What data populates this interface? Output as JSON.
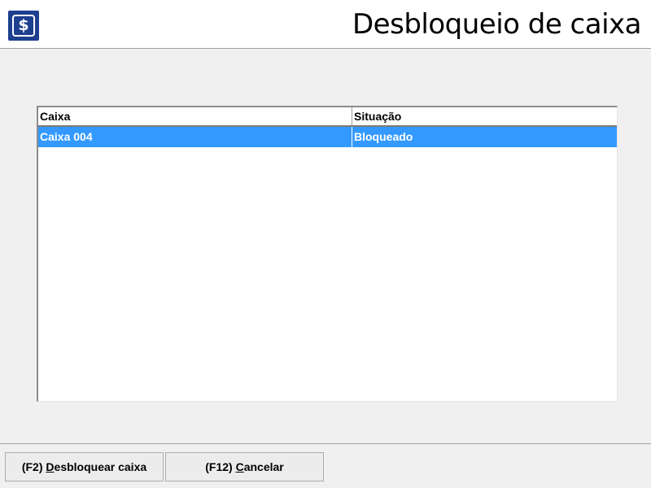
{
  "header": {
    "logo_glyph": "$",
    "logo_icon": "cash-icon",
    "title": "Desbloqueio de caixa"
  },
  "grid": {
    "columns": [
      "Caixa",
      "Situação"
    ],
    "rows": [
      {
        "caixa": "Caixa 004",
        "situacao": "Bloqueado",
        "selected": true
      }
    ],
    "selection_color": "#3399ff"
  },
  "buttons": {
    "unlock": {
      "prefix": "(F2) ",
      "mnemonic": "D",
      "rest": "esbloquear caixa"
    },
    "cancel": {
      "prefix": "(F12) ",
      "mnemonic": "C",
      "rest": "ancelar"
    }
  },
  "colors": {
    "header_bg": "#ffffff",
    "body_bg": "#f0f0f0",
    "logo_bg": "#1d3f8f"
  }
}
